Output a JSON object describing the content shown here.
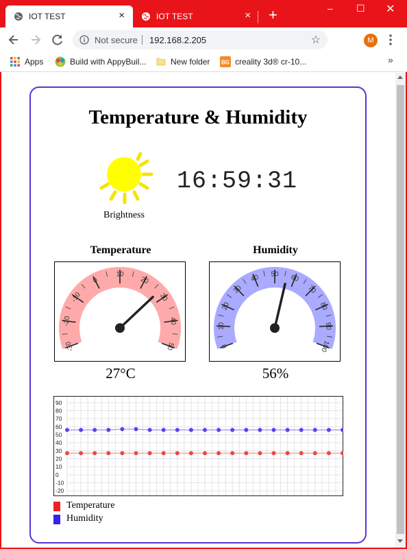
{
  "browser": {
    "tabs": [
      {
        "title": "IOT TEST",
        "close": "×"
      },
      {
        "title": "IOT TEST",
        "close": "×"
      }
    ],
    "new_tab": "+",
    "window_controls": {
      "minimize": "–",
      "maximize": "☐",
      "close": "✕"
    },
    "address": {
      "security": "Not secure",
      "url": "192.168.2.205",
      "star": "☆"
    },
    "profile_initial": "M",
    "bookmarks": [
      {
        "label": "Apps",
        "icon": "apps-grid-icon"
      },
      {
        "label": "Build with AppyBuil...",
        "icon": "appybuilder-icon"
      },
      {
        "label": "New folder",
        "icon": "folder-icon"
      },
      {
        "label": "creality 3d® cr-10...",
        "icon": "bg-icon"
      }
    ],
    "bookmarks_more": "»",
    "colors": {
      "titlebar": "#e8141a",
      "card_border": "#5a34d6"
    }
  },
  "page": {
    "title": "Temperature & Humidity",
    "brightness_label": "Brightness",
    "time": "16:59:31",
    "temperature": {
      "title": "Temperature",
      "value": 27,
      "display": "27°C",
      "min": -30,
      "max": 50,
      "ticks": [
        "-30",
        "-20",
        "-10",
        "0",
        "10",
        "20",
        "30",
        "40",
        "50"
      ],
      "color": "#ffaaaa"
    },
    "humidity": {
      "title": "Humidity",
      "value": 56,
      "display": "56%",
      "min": 0,
      "max": 100,
      "ticks": [
        "0",
        "10",
        "20",
        "30",
        "40",
        "50",
        "60",
        "70",
        "80",
        "90",
        "100"
      ],
      "color": "#aaaaff"
    },
    "legend": [
      {
        "label": "Temperature",
        "color": "#ee2222"
      },
      {
        "label": "Humidity",
        "color": "#3322ee"
      }
    ]
  },
  "chart_data": {
    "type": "line",
    "y_ticks": [
      90,
      80,
      70,
      60,
      50,
      40,
      30,
      20,
      10,
      0,
      -10,
      -20
    ],
    "ylim": [
      -25,
      95
    ],
    "grid": true,
    "series": [
      {
        "name": "Temperature",
        "color": "#ee4444",
        "values": [
          27,
          27,
          27,
          27,
          27,
          27,
          27,
          27,
          27,
          27,
          27,
          27,
          27,
          27,
          27,
          27,
          27,
          27,
          27,
          27,
          27
        ]
      },
      {
        "name": "Humidity",
        "color": "#5544ee",
        "values": [
          56,
          56,
          56,
          56,
          57,
          57,
          56,
          56,
          56,
          56,
          56,
          56,
          56,
          56,
          56,
          56,
          56,
          56,
          56,
          56,
          56
        ]
      }
    ]
  }
}
